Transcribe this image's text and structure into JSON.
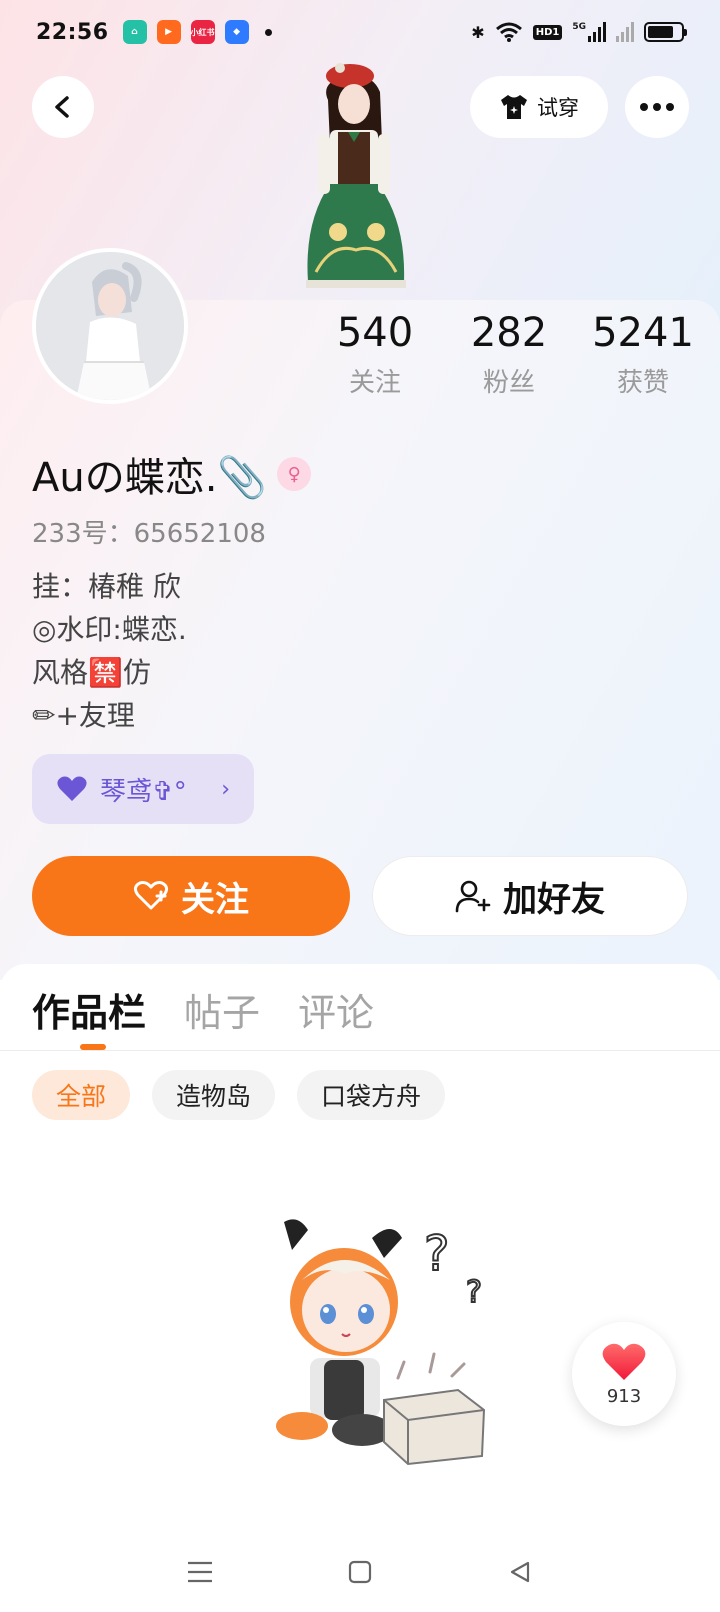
{
  "status_bar": {
    "time": "22:56",
    "apps": [
      {
        "name": "home-app-icon",
        "color": "#24c1a6",
        "label": ""
      },
      {
        "name": "kuaishou-app-icon",
        "color": "#ff6a1f",
        "label": ""
      },
      {
        "name": "xiaohongshu-app-icon",
        "color": "#ea2543",
        "label": "小红书"
      },
      {
        "name": "blue-app-icon",
        "color": "#2f7bff",
        "label": ""
      }
    ],
    "hd_label": "HD1",
    "network_label": "5G"
  },
  "header": {
    "try_on_label": "试穿"
  },
  "profile": {
    "nickname": "Auの蝶恋.📎",
    "gender_symbol": "♀",
    "uid_label": "233号：",
    "uid": "65652108",
    "bio_lines": [
      "挂：椿稚 欣",
      "◎水印:蝶恋.",
      "风格🈲仿",
      "✏+友理"
    ],
    "tag": {
      "label": "琴鸢✞°",
      "icon": "heart-icon"
    }
  },
  "stats": [
    {
      "value": "540",
      "label": "关注"
    },
    {
      "value": "282",
      "label": "粉丝"
    },
    {
      "value": "5241",
      "label": "获赞"
    }
  ],
  "actions": {
    "follow_label": "关注",
    "add_friend_label": "加好友"
  },
  "tabs": [
    {
      "label": "作品栏",
      "active": true
    },
    {
      "label": "帖子",
      "active": false
    },
    {
      "label": "评论",
      "active": false
    }
  ],
  "filters": [
    {
      "label": "全部",
      "active": true
    },
    {
      "label": "造物岛",
      "active": false
    },
    {
      "label": "口袋方舟",
      "active": false
    }
  ],
  "like_float": {
    "count": "913"
  },
  "colors": {
    "accent": "#f87618",
    "tag_text": "#6b56d6",
    "tag_bg": "#e5e0f6"
  }
}
